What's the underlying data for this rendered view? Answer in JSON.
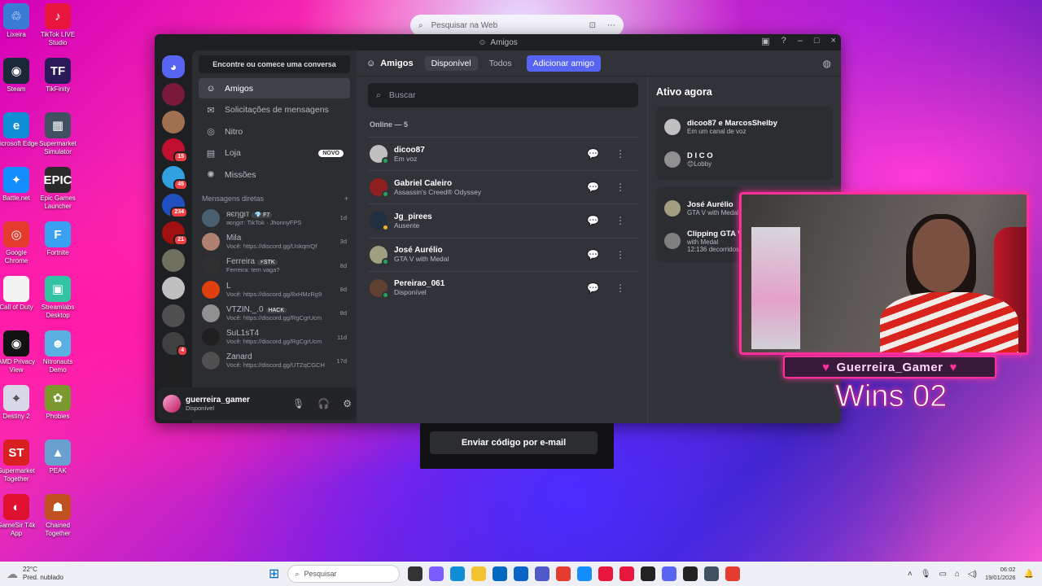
{
  "desktop": {
    "col1": [
      {
        "label": "Lixeira",
        "icon": "recycle-bin-icon",
        "color": "#3a7bd5",
        "glyph": "♲"
      },
      {
        "label": "Steam",
        "icon": "steam-icon",
        "color": "#1b2838",
        "glyph": "◉"
      },
      {
        "label": "Microsoft Edge",
        "icon": "edge-icon",
        "color": "#0f8ed6",
        "glyph": "e"
      },
      {
        "label": "Battle.net",
        "icon": "battlenet-icon",
        "color": "#148eff",
        "glyph": "✦"
      },
      {
        "label": "Google Chrome",
        "icon": "chrome-icon",
        "color": "#e33b2e",
        "glyph": "◎"
      },
      {
        "label": "Call of Duty",
        "icon": "file-icon",
        "color": "#f2f2f2",
        "glyph": ""
      },
      {
        "label": "AMD Privacy View",
        "icon": "amd-icon",
        "color": "#111111",
        "glyph": "◉"
      },
      {
        "label": "Destiny 2",
        "icon": "destiny-icon",
        "color": "#d8d8e8",
        "glyph": "⌖"
      },
      {
        "label": "Supermarket Together",
        "icon": "supermarket-together-icon",
        "color": "#d82020",
        "glyph": "ST"
      },
      {
        "label": "GameSir T4k App",
        "icon": "gamesir-icon",
        "color": "#e01030",
        "glyph": "◐"
      }
    ],
    "col2": [
      {
        "label": "TikTok LIVE Studio",
        "icon": "tiktok-live-icon",
        "color": "#e8163c",
        "glyph": "♪"
      },
      {
        "label": "TikFinity",
        "icon": "tikfinity-icon",
        "color": "#2a1a5a",
        "glyph": "TF"
      },
      {
        "label": "Supermarket Simulator",
        "icon": "supermarket-sim-icon",
        "color": "#405060",
        "glyph": "▦"
      },
      {
        "label": "Epic Games Launcher",
        "icon": "epic-games-icon",
        "color": "#2a2a2a",
        "glyph": "EPIC"
      },
      {
        "label": "Fortnite",
        "icon": "fortnite-icon",
        "color": "#3aa0f0",
        "glyph": "F"
      },
      {
        "label": "Streamlabs Desktop",
        "icon": "streamlabs-icon",
        "color": "#31c3a2",
        "glyph": "▣"
      },
      {
        "label": "Nitronauts Demo",
        "icon": "nitronauts-icon",
        "color": "#5ab0e0",
        "glyph": "☻"
      },
      {
        "label": "Phobies",
        "icon": "phobies-icon",
        "color": "#7a9a30",
        "glyph": "✿"
      },
      {
        "label": "PEAK",
        "icon": "peak-icon",
        "color": "#6aa0d0",
        "glyph": "▲"
      },
      {
        "label": "Chained Together",
        "icon": "chained-together-icon",
        "color": "#c05020",
        "glyph": "☗"
      }
    ]
  },
  "websearch": {
    "placeholder": "Pesquisar na Web"
  },
  "discord": {
    "window_title": "Amigos",
    "finder": "Encontre ou comece uma conversa",
    "servers": [
      {
        "color": "#7a1a3a",
        "badge": ""
      },
      {
        "color": "#a07050",
        "badge": ""
      },
      {
        "color": "#c01030",
        "badge": "15"
      },
      {
        "color": "#30a0e0",
        "badge": "45"
      },
      {
        "color": "#2050c0",
        "badge": "234"
      },
      {
        "color": "#a01010",
        "badge": "21"
      },
      {
        "color": "#707060",
        "badge": ""
      },
      {
        "color": "#c0c0c0",
        "badge": ""
      },
      {
        "color": "#505050",
        "badge": ""
      },
      {
        "color": "#404040",
        "badge": "4"
      },
      {
        "color": "#202020",
        "badge": ""
      }
    ],
    "nav": {
      "friends": "Amigos",
      "requests": "Solicitações de mensagens",
      "nitro": "Nitro",
      "shop": "Loja",
      "shop_badge": "NOVO",
      "quests": "Missões"
    },
    "dm_header": "Mensagens diretas",
    "dms": [
      {
        "name": "яєηgιт",
        "tag": "💎 F7",
        "sub": "яєηgιт: TikTok · JhonnyFPS",
        "days": "1d",
        "color": "#4a6070"
      },
      {
        "name": "Mila",
        "tag": "",
        "sub": "Você: https://discord.gg/UskqmQf",
        "days": "3d",
        "color": "#b08070"
      },
      {
        "name": "Ferreira",
        "tag": "⚡STK",
        "sub": "Ferreira: tem vaga?",
        "days": "8d",
        "color": "#303030"
      },
      {
        "name": "L",
        "tag": "",
        "sub": "Você: https://discord.gg/8xHMzRg9",
        "days": "8d",
        "color": "#e04010"
      },
      {
        "name": "VTZIN._.0",
        "tag": "HACK",
        "sub": "Você: https://discord.gg/RgCgrUcm",
        "days": "8d",
        "color": "#909090"
      },
      {
        "name": "SuL1sT4",
        "tag": "",
        "sub": "Você: https://discord.gg/RgCgrUcm",
        "days": "11d",
        "color": "#202020"
      },
      {
        "name": "Zanard",
        "tag": "",
        "sub": "Você: https://discord.gg/UTZqCGCH",
        "days": "17d",
        "color": "#505050"
      }
    ],
    "user": {
      "name": "guerreira_gamer",
      "status": "Disponível"
    },
    "toolbar": {
      "title": "Amigos",
      "tab_available": "Disponível",
      "tab_all": "Todos",
      "add_friend": "Adicionar amigo"
    },
    "search_placeholder": "Buscar",
    "online_header": "Online — 5",
    "friends": [
      {
        "name": "dicoo87",
        "status": "Em voz",
        "color": "#c0c0c0",
        "dot": "#23a55a"
      },
      {
        "name": "Gabriel Caleiro",
        "status": "Assassin's Creed® Odyssey",
        "color": "#902020",
        "dot": "#23a55a"
      },
      {
        "name": "Jg_pirees",
        "status": "Ausente",
        "color": "#203040",
        "dot": "#f0b232"
      },
      {
        "name": "José Aurélio",
        "status": "GTA V with Medal",
        "color": "#a0a080",
        "dot": "#23a55a"
      },
      {
        "name": "Pereirao_061",
        "status": "Disponível",
        "color": "#604030",
        "dot": "#23a55a"
      }
    ],
    "active_now": {
      "title": "Ativo agora",
      "card1": [
        {
          "name": "dicoo87 e MarcosShelby",
          "status": "Em um canal de voz",
          "color": "#c0c0c0"
        },
        {
          "name": "D I C O",
          "status": "😊Lobby",
          "color": "#909090"
        }
      ],
      "card2": [
        {
          "name": "José Aurélio",
          "status": "GTA V with Medal",
          "color": "#a0a080"
        },
        {
          "name": "Clipping GTA V",
          "status": "with Medal",
          "extra": "12:136 decorridos",
          "color": "#808080"
        }
      ]
    }
  },
  "overlay": {
    "name": "Guerreira_Gamer",
    "wins": "Wins 02"
  },
  "email_button": "Enviar código por e-mail",
  "taskbar": {
    "temp": "22°C",
    "weather": "Pred. nublado",
    "search": "Pesquisar",
    "time": "06:02",
    "date": "19/01/2026"
  }
}
